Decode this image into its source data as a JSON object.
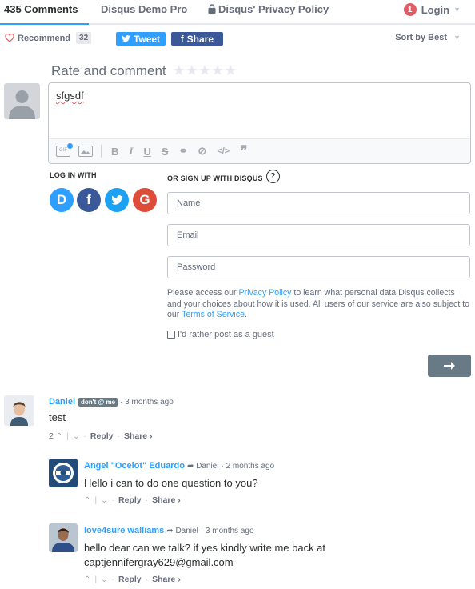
{
  "nav": {
    "comments_tab": "435 Comments",
    "community_tab": "Disqus Demo Pro",
    "privacy_tab": "Disqus' Privacy Policy",
    "notification_count": "1",
    "login": "Login"
  },
  "toolbar": {
    "recommend": "Recommend",
    "recommend_count": "32",
    "tweet": "Tweet",
    "share": "Share",
    "sort": "Sort by Best"
  },
  "composer": {
    "title": "Rate and comment",
    "stars": "★★★★★",
    "text": "sfgsdf",
    "toolbar_icons": [
      "gif-icon",
      "image-icon",
      "bold-icon",
      "italic-icon",
      "underline-icon",
      "strikethrough-icon",
      "link-icon",
      "spoiler-icon",
      "code-icon",
      "quote-icon"
    ]
  },
  "auth": {
    "login_with": "LOG IN WITH",
    "signup_with": "OR SIGN UP WITH DISQUS",
    "name_placeholder": "Name",
    "email_placeholder": "Email",
    "password_placeholder": "Password",
    "privacy_pre": "Please access our ",
    "privacy_link": "Privacy Policy",
    "privacy_mid": " to learn what personal data Disqus collects and your choices about how it is used. All users of our service are also subject to our ",
    "terms_link": "Terms of Service",
    "privacy_post": ".",
    "guest": "I'd rather post as a guest"
  },
  "comments": [
    {
      "author": "Daniel",
      "badge": "don't @ me",
      "time": "· 3 months ago",
      "text": "test",
      "votes": "2",
      "reply": "Reply",
      "share": "Share ›"
    },
    {
      "author": "Angel \"Ocelot\" Eduardo",
      "reply_to": "➦ Daniel",
      "time": "· 2 months ago",
      "text": "Hello i can to do one question to you?",
      "reply": "Reply",
      "share": "Share ›"
    },
    {
      "author": "love4sure walliams",
      "reply_to": "➦ Daniel",
      "time": "· 3 months ago",
      "text_line1": "hello dear can we talk? if yes kindly write me back at",
      "text_line2": "captjennifergray629@gmail.com",
      "reply": "Reply",
      "share": "Share ›"
    }
  ],
  "colors": {
    "accent": "#2e9fff",
    "facebook": "#3b5998",
    "google": "#dd4b39",
    "badge_red": "#e25c66",
    "submit": "#687a86"
  }
}
